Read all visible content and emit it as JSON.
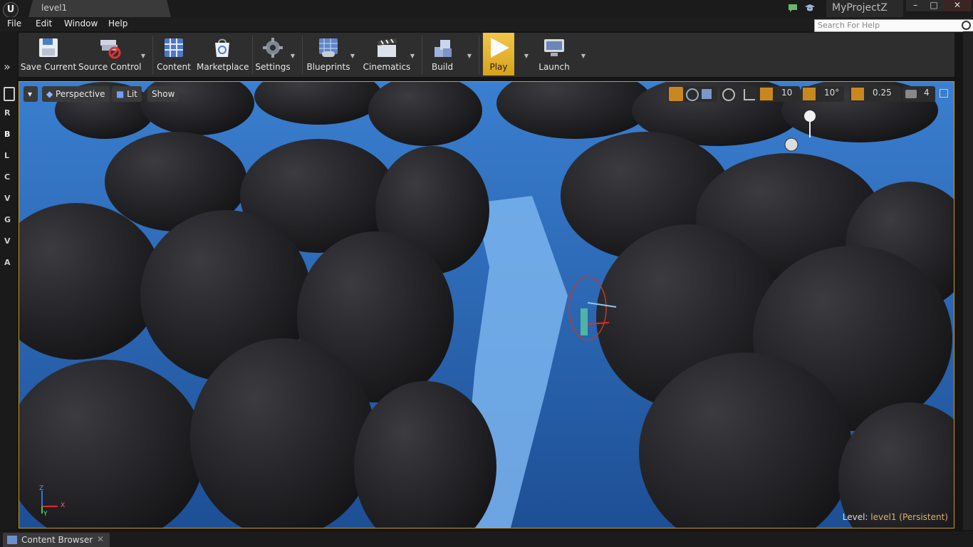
{
  "window": {
    "tab_title": "level1",
    "project_name": "MyProjectZ",
    "minimize": "–",
    "maximize": "□",
    "close": "✕"
  },
  "menu": [
    "File",
    "Edit",
    "Window",
    "Help"
  ],
  "search": {
    "placeholder": "Search For Help"
  },
  "side_tabs": [
    "R",
    "B",
    "L",
    "C",
    "V",
    "G",
    "V",
    "A"
  ],
  "toolbar": {
    "save_current": "Save Current",
    "source_control": "Source Control",
    "content": "Content",
    "marketplace": "Marketplace",
    "settings": "Settings",
    "blueprints": "Blueprints",
    "cinematics": "Cinematics",
    "build": "Build",
    "play": "Play",
    "launch": "Launch"
  },
  "viewport": {
    "perspective": "Perspective",
    "lit": "Lit",
    "show": "Show",
    "grid_snap": "10",
    "rotation_snap": "10°",
    "scale_snap": "0.25",
    "camera_speed": "4",
    "level_prefix": "Level:",
    "level_name": "level1 (Persistent)",
    "axis_x": "X",
    "axis_z": "Z",
    "axis_y": "Y"
  },
  "bottom": {
    "content_browser": "Content Browser"
  },
  "colors": {
    "accent": "#c79a23",
    "play": "#e2b230",
    "water": "#3f8ed8",
    "rock": "#222226"
  }
}
